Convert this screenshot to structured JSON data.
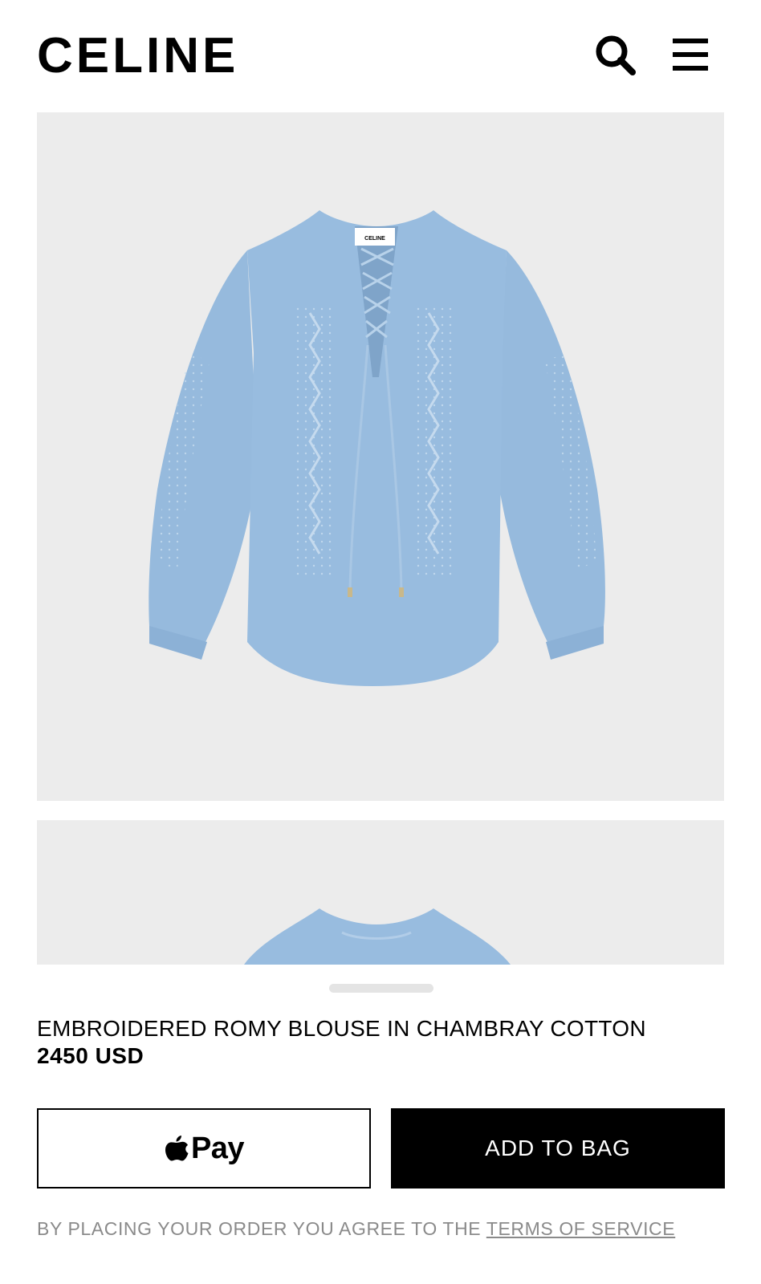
{
  "header": {
    "logo": "CELINE",
    "search_icon": "search-icon",
    "menu_icon": "hamburger-menu-icon"
  },
  "gallery": {
    "background_color": "#ececec",
    "images": [
      {
        "name": "product-image-front",
        "description_icon": "blouse-image"
      },
      {
        "name": "product-image-second",
        "description_icon": "blouse-image"
      }
    ],
    "garment_label": "CELINE"
  },
  "product": {
    "name": "EMBROIDERED ROMY BLOUSE IN CHAMBRAY COTTON",
    "price": "2450 USD"
  },
  "actions": {
    "apple_pay_label": "Pay",
    "apple_pay_icon": "apple-logo-icon",
    "add_to_bag_label": "ADD TO BAG"
  },
  "terms": {
    "prefix": "BY PLACING YOUR ORDER YOU AGREE TO THE",
    "link_label": "TERMS OF SERVICE"
  },
  "colors": {
    "accent": "#000000",
    "muted_text": "#8a8a8a",
    "blouse": "#98bcdf"
  }
}
